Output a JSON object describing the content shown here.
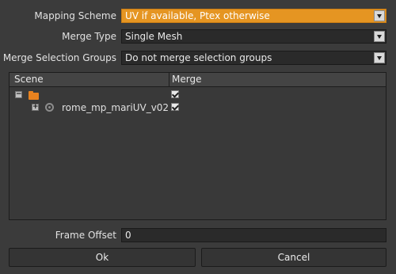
{
  "form": {
    "mapping_scheme": {
      "label": "Mapping Scheme",
      "value": "UV if available, Ptex otherwise"
    },
    "merge_type": {
      "label": "Merge Type",
      "value": "Single Mesh"
    },
    "merge_selection_groups": {
      "label": "Merge Selection Groups",
      "value": "Do not merge selection groups"
    },
    "frame_offset": {
      "label": "Frame Offset",
      "value": "0"
    }
  },
  "tree": {
    "columns": {
      "scene": "Scene",
      "merge": "Merge"
    },
    "rows": [
      {
        "label": "",
        "expander": "−",
        "icon": "folder-icon",
        "merge_checked": true
      },
      {
        "label": "rome_mp_mariUV_v02",
        "expander": "+",
        "icon": "object-icon",
        "merge_checked": true
      }
    ]
  },
  "buttons": {
    "ok": "Ok",
    "cancel": "Cancel"
  },
  "colors": {
    "accent": "#e59522",
    "background": "#3b3b3b",
    "folder": "#e8821f"
  }
}
